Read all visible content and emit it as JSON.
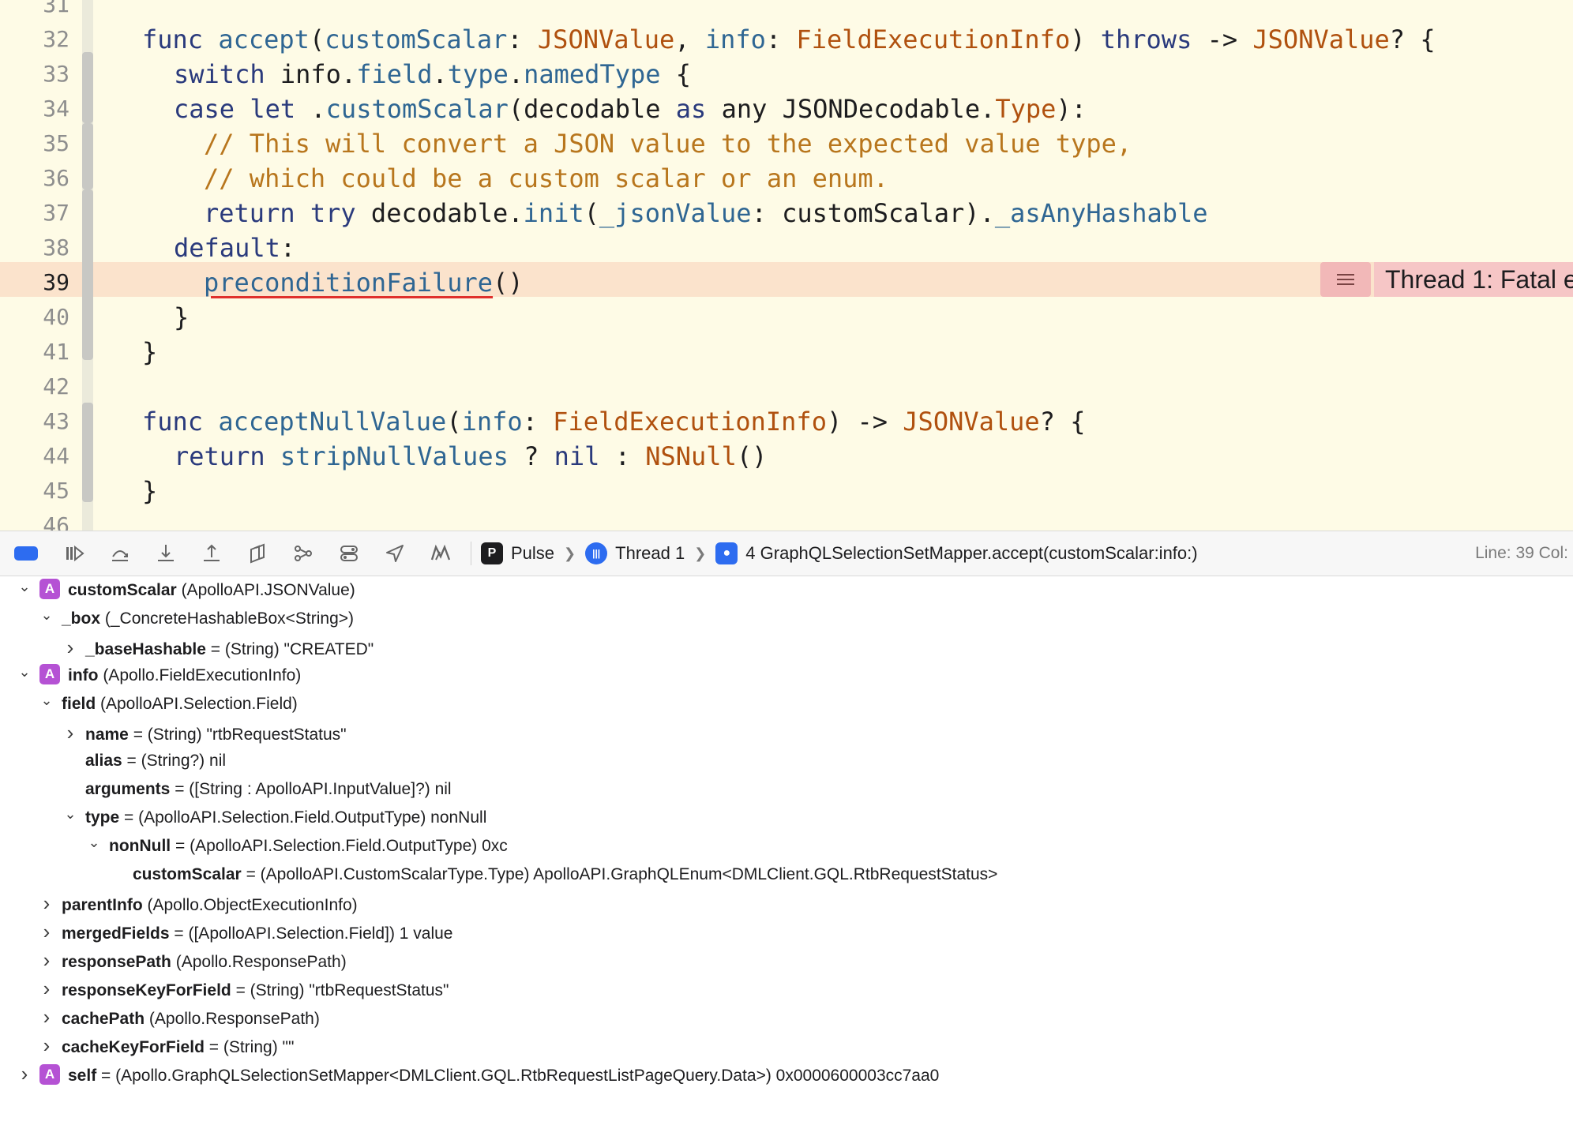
{
  "editor": {
    "line_numbers": [
      "31",
      "32",
      "33",
      "34",
      "35",
      "36",
      "37",
      "38",
      "39",
      "40",
      "41",
      "42",
      "43",
      "44",
      "45",
      "46"
    ],
    "current_line": "39",
    "lines": [
      [],
      [
        [
          "kw",
          "func "
        ],
        [
          "fn",
          "accept"
        ],
        [
          "",
          "("
        ],
        [
          "fn",
          "customScalar"
        ],
        [
          "",
          ": "
        ],
        [
          "ty",
          "JSONValue"
        ],
        [
          "",
          ", "
        ],
        [
          "fn",
          "info"
        ],
        [
          "",
          ": "
        ],
        [
          "ty",
          "FieldExecutionInfo"
        ],
        [
          "",
          ") "
        ],
        [
          "kw",
          "throws"
        ],
        [
          "",
          " -> "
        ],
        [
          "ty",
          "JSONValue"
        ],
        [
          "",
          "? {"
        ]
      ],
      [
        [
          "",
          ""
        ],
        [
          "kw",
          "switch "
        ],
        [
          "",
          "info."
        ],
        [
          "fn",
          "field"
        ],
        [
          "",
          "."
        ],
        [
          "fn",
          "type"
        ],
        [
          "",
          "."
        ],
        [
          "fn",
          "namedType"
        ],
        [
          "",
          " {"
        ]
      ],
      [
        [
          "kw",
          "case let "
        ],
        [
          "",
          "."
        ],
        [
          "fn",
          "customScalar"
        ],
        [
          "",
          "(decodable "
        ],
        [
          "kw",
          "as "
        ],
        [
          "",
          "any JSONDecodable."
        ],
        [
          "ty",
          "Type"
        ],
        [
          "",
          "):"
        ]
      ],
      [
        [
          "cm",
          "// This will convert a JSON value to the expected value type,"
        ]
      ],
      [
        [
          "cm",
          "// which could be a custom scalar or an enum."
        ]
      ],
      [
        [
          "kw",
          "return try "
        ],
        [
          "",
          "decodable."
        ],
        [
          "fn",
          "init"
        ],
        [
          "",
          "("
        ],
        [
          "fn",
          "_jsonValue"
        ],
        [
          "",
          ": customScalar)."
        ],
        [
          "fn",
          "_asAnyHashable"
        ]
      ],
      [
        [
          "kw",
          "default"
        ],
        [
          "",
          ":"
        ]
      ],
      [
        [
          "fn",
          "preconditionFailure"
        ],
        [
          "",
          "()"
        ]
      ],
      [
        [
          "",
          "}"
        ]
      ],
      [
        [
          "",
          "}"
        ]
      ],
      [],
      [
        [
          "kw",
          "func "
        ],
        [
          "fn",
          "acceptNullValue"
        ],
        [
          "",
          "("
        ],
        [
          "fn",
          "info"
        ],
        [
          "",
          ": "
        ],
        [
          "ty",
          "FieldExecutionInfo"
        ],
        [
          "",
          ") -> "
        ],
        [
          "ty",
          "JSONValue"
        ],
        [
          "",
          "? {"
        ]
      ],
      [
        [
          "kw",
          "return "
        ],
        [
          "fn",
          "stripNullValues"
        ],
        [
          "",
          " ? "
        ],
        [
          "kw",
          "nil"
        ],
        [
          "",
          " : "
        ],
        [
          "ty",
          "NSNull"
        ],
        [
          "",
          "()"
        ]
      ],
      [
        [
          "",
          "}"
        ]
      ],
      []
    ],
    "error_message": "Thread 1: Fatal e"
  },
  "debug_bar": {
    "crumbs": [
      {
        "label": "Pulse",
        "icon": "pulse-app-icon",
        "icon_char": "P",
        "color": "#1d1d1f"
      },
      {
        "label": "Thread 1",
        "icon": "thread-icon",
        "icon_char": "|||",
        "color": "#2d6cf0"
      },
      {
        "label": "4 GraphQLSelectionSetMapper.accept(customScalar:info:)",
        "icon": "frame-user-icon",
        "icon_char": "●",
        "color": "#2d6cf0"
      }
    ],
    "line_col": "Line: 39  Col:"
  },
  "variables": [
    {
      "depth": 0,
      "tri": "open",
      "badge": "A",
      "name": "customScalar",
      "rest": " (ApolloAPI.JSONValue)"
    },
    {
      "depth": 1,
      "tri": "open",
      "name": "_box",
      "rest": " (_ConcreteHashableBox<String>)"
    },
    {
      "depth": 2,
      "tri": "closed",
      "name": "_baseHashable",
      "rest": " = (String) \"CREATED\""
    },
    {
      "depth": 0,
      "tri": "open",
      "badge": "A",
      "name": "info",
      "rest": " (Apollo.FieldExecutionInfo)"
    },
    {
      "depth": 1,
      "tri": "open",
      "name": "field",
      "rest": " (ApolloAPI.Selection.Field)"
    },
    {
      "depth": 2,
      "tri": "closed",
      "name": "name",
      "rest": " = (String) \"rtbRequestStatus\""
    },
    {
      "depth": 2,
      "tri": "none",
      "name": "alias",
      "rest": " = (String?) nil"
    },
    {
      "depth": 2,
      "tri": "none",
      "name": "arguments",
      "rest": " = ([String : ApolloAPI.InputValue]?) nil"
    },
    {
      "depth": 2,
      "tri": "open",
      "name": "type",
      "rest": " = (ApolloAPI.Selection.Field.OutputType) nonNull"
    },
    {
      "depth": 3,
      "tri": "open",
      "name": "nonNull",
      "rest": " = (ApolloAPI.Selection.Field.OutputType) 0xc"
    },
    {
      "depth": 4,
      "tri": "none",
      "name": "customScalar",
      "rest": " = (ApolloAPI.CustomScalarType.Type) ApolloAPI.GraphQLEnum<DMLClient.GQL.RtbRequestStatus>"
    },
    {
      "depth": 1,
      "tri": "closed",
      "name": "parentInfo",
      "rest": " (Apollo.ObjectExecutionInfo)"
    },
    {
      "depth": 1,
      "tri": "closed",
      "name": "mergedFields",
      "rest": " = ([ApolloAPI.Selection.Field]) 1 value"
    },
    {
      "depth": 1,
      "tri": "closed",
      "name": "responsePath",
      "rest": " (Apollo.ResponsePath)"
    },
    {
      "depth": 1,
      "tri": "closed",
      "name": "responseKeyForField",
      "rest": " = (String) \"rtbRequestStatus\""
    },
    {
      "depth": 1,
      "tri": "closed",
      "name": "cachePath",
      "rest": " (Apollo.ResponsePath)"
    },
    {
      "depth": 1,
      "tri": "closed",
      "name": "cacheKeyForField",
      "rest": " = (String) \"\""
    },
    {
      "depth": 0,
      "tri": "closed",
      "badge": "A",
      "name": "self",
      "rest": " = (Apollo.GraphQLSelectionSetMapper<DMLClient.GQL.RtbRequestListPageQuery.Data>) 0x0000600003cc7aa0"
    }
  ]
}
